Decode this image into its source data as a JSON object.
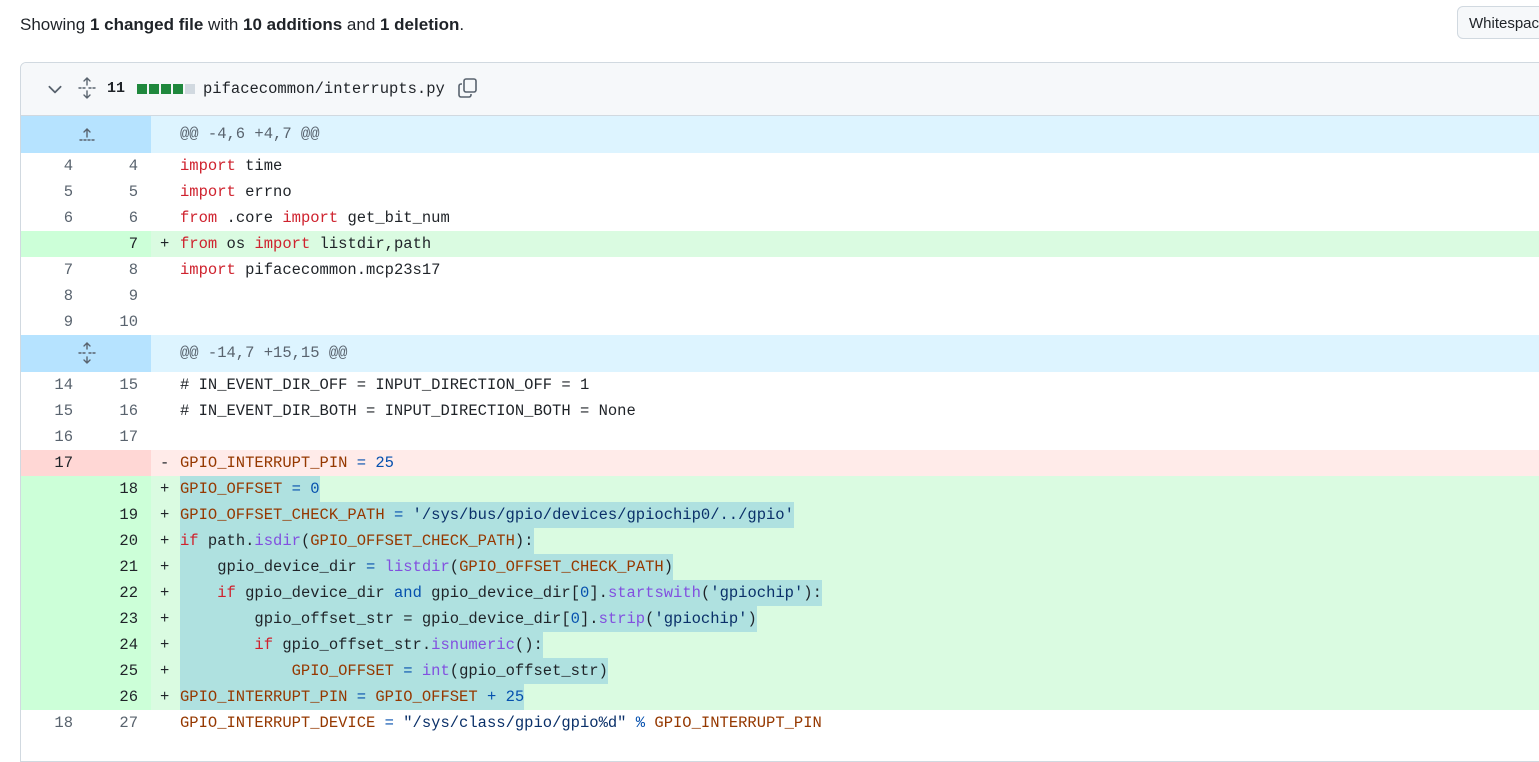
{
  "summary": {
    "prefix": "Showing ",
    "files": "1 changed file",
    "mid1": " with ",
    "additions": "10 additions",
    "mid2": " and ",
    "deletions": "1 deletion",
    "suffix": "."
  },
  "whitespace_button": "Whitespace",
  "file": {
    "change_count": "11",
    "path": "pifacecommon/interrupts.py",
    "diffstat": {
      "added_blocks": 4,
      "neutral_blocks": 1
    },
    "colors": {
      "added": "#1f883d",
      "neutral": "#d1d9e0"
    }
  },
  "hunks": [
    {
      "header": "@@ -4,6 +4,7 @@"
    },
    {
      "header": "@@ -14,7 +15,15 @@"
    }
  ],
  "lines": [
    {
      "old": "4",
      "new": "4",
      "m": " "
    },
    {
      "old": "5",
      "new": "5",
      "m": " "
    },
    {
      "old": "6",
      "new": "6",
      "m": " "
    },
    {
      "old": "",
      "new": "7",
      "m": "+"
    },
    {
      "old": "7",
      "new": "8",
      "m": " "
    },
    {
      "old": "8",
      "new": "9",
      "m": " "
    },
    {
      "old": "9",
      "new": "10",
      "m": " "
    },
    {
      "old": "14",
      "new": "15",
      "m": " "
    },
    {
      "old": "15",
      "new": "16",
      "m": " "
    },
    {
      "old": "16",
      "new": "17",
      "m": " "
    },
    {
      "old": "17",
      "new": "",
      "m": "-"
    },
    {
      "old": "",
      "new": "18",
      "m": "+"
    },
    {
      "old": "",
      "new": "19",
      "m": "+"
    },
    {
      "old": "",
      "new": "20",
      "m": "+"
    },
    {
      "old": "",
      "new": "21",
      "m": "+"
    },
    {
      "old": "",
      "new": "22",
      "m": "+"
    },
    {
      "old": "",
      "new": "23",
      "m": "+"
    },
    {
      "old": "",
      "new": "24",
      "m": "+"
    },
    {
      "old": "",
      "new": "25",
      "m": "+"
    },
    {
      "old": "",
      "new": "26",
      "m": "+"
    },
    {
      "old": "18",
      "new": "27",
      "m": " "
    }
  ],
  "code": {
    "l4": [
      "import",
      " time"
    ],
    "l5": [
      "import",
      " errno"
    ],
    "l6": [
      "from",
      " .core ",
      "import",
      " get_bit_num"
    ],
    "l7": [
      "from",
      " os ",
      "import",
      " listdir,path"
    ],
    "l8": [
      "import",
      " pifacecommon.mcp23s17"
    ],
    "l15": "# IN_EVENT_DIR_OFF = INPUT_DIRECTION_OFF = 1",
    "l16": "# IN_EVENT_DIR_BOTH = INPUT_DIRECTION_BOTH = None",
    "del17": [
      "GPIO_INTERRUPT_PIN",
      " = ",
      "25"
    ],
    "a18": [
      "GPIO_OFFSET",
      " = ",
      "0"
    ],
    "a19": [
      "GPIO_OFFSET_CHECK_PATH",
      " = ",
      "'/sys/bus/gpio/devices/gpiochip0/../gpio'"
    ],
    "a20": [
      "if",
      " path.",
      "isdir",
      "(",
      "GPIO_OFFSET_CHECK_PATH",
      "):"
    ],
    "a21": [
      "    gpio_device_dir ",
      "=",
      " ",
      "listdir",
      "(",
      "GPIO_OFFSET_CHECK_PATH",
      ")"
    ],
    "a22": [
      "    ",
      "if",
      " gpio_device_dir ",
      "and",
      " gpio_device_dir[",
      "0",
      "].",
      "startswith",
      "(",
      "'gpiochip'",
      "):"
    ],
    "a23": [
      "        gpio_offset_str = gpio_device_dir[",
      "0",
      "].",
      "strip",
      "(",
      "'gpiochip'",
      ")"
    ],
    "a24": [
      "        ",
      "if",
      " gpio_offset_str.",
      "isnumeric",
      "():"
    ],
    "a25": [
      "            ",
      "GPIO_OFFSET",
      " = ",
      "int",
      "(gpio_offset_str)"
    ],
    "a26": [
      "GPIO_INTERRUPT_PIN",
      " = ",
      "GPIO_OFFSET",
      " + ",
      "25"
    ],
    "l27": [
      "GPIO_INTERRUPT_DEVICE",
      " = ",
      "\"/sys/class/gpio/gpio%d\"",
      " % ",
      "GPIO_INTERRUPT_PIN"
    ]
  }
}
